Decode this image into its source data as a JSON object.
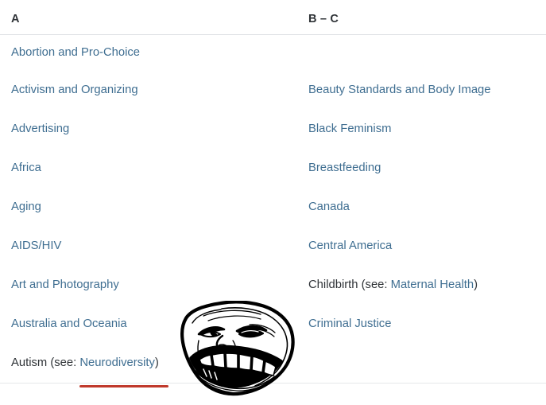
{
  "table": {
    "columns": [
      {
        "id": "a",
        "header": "A"
      },
      {
        "id": "bc",
        "header": "B – C"
      }
    ],
    "rows": [
      {
        "a": {
          "text": "Abortion and Pro-Choice",
          "type": "link"
        },
        "bc": {
          "text": "",
          "type": "empty"
        }
      },
      {
        "a": {
          "text": "Activism and Organizing",
          "type": "link"
        },
        "bc": {
          "text": "Beauty Standards and Body Image",
          "type": "link"
        }
      },
      {
        "a": {
          "text": "Advertising",
          "type": "link"
        },
        "bc": {
          "text": "Black Feminism",
          "type": "link"
        }
      },
      {
        "a": {
          "text": "Africa",
          "type": "link"
        },
        "bc": {
          "text": "Breastfeeding",
          "type": "link"
        }
      },
      {
        "a": {
          "text": "Aging",
          "type": "link"
        },
        "bc": {
          "text": "Canada",
          "type": "link"
        }
      },
      {
        "a": {
          "text": "AIDS/HIV",
          "type": "link"
        },
        "bc": {
          "text": "Central America",
          "type": "link"
        }
      },
      {
        "a": {
          "text": "Art and Photography",
          "type": "link"
        },
        "bc": {
          "prefix": "Childbirth (see: ",
          "text": "Maternal Health",
          "suffix": ")",
          "type": "see-also"
        }
      },
      {
        "a": {
          "text": "Australia and Oceania",
          "type": "link"
        },
        "bc": {
          "text": "Criminal Justice",
          "type": "link"
        }
      },
      {
        "a": {
          "prefix": "Autism (see: ",
          "text": "Neurodiversity",
          "suffix": ")",
          "type": "see-also",
          "annotated": true
        },
        "bc": {
          "text": "",
          "type": "empty"
        }
      }
    ]
  },
  "cells": {
    "r0a": "Abortion and Pro-Choice",
    "r1a": "Activism and Organizing",
    "r2a": "Advertising",
    "r3a": "Africa",
    "r4a": "Aging",
    "r5a": "AIDS/HIV",
    "r6a": "Art and Photography",
    "r7a": "Australia and Oceania",
    "r8a_prefix": "Autism (see: ",
    "r8a_link": "Neurodiversity",
    "r8a_suffix": ")",
    "r1bc": "Beauty Standards and Body Image",
    "r2bc": "Black Feminism",
    "r3bc": "Breastfeeding",
    "r4bc": "Canada",
    "r5bc": "Central America",
    "r6bc_prefix": "Childbirth (see: ",
    "r6bc_link": "Maternal Health",
    "r6bc_suffix": ")",
    "r7bc": "Criminal Justice"
  },
  "headers": {
    "a": "A",
    "bc": "B – C"
  },
  "overlay": {
    "image_name": "trollface-meme",
    "annotation_name": "red-underline-annotation"
  },
  "colors": {
    "link": "#3f6e91",
    "text": "#2f3337",
    "rule": "#dfe2e5",
    "annotation": "#c0392b",
    "background": "#ffffff"
  }
}
